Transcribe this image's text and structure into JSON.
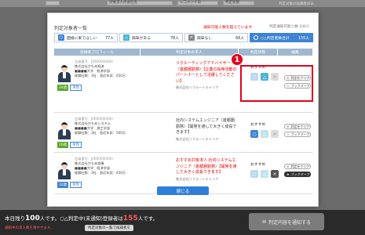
{
  "background": {
    "fields": [
      "",
      "対象求人の会社名",
      "レコメンド日",
      "判定状態"
    ],
    "checkbox_label": "判定対象の候補者のみ",
    "footer": {
      "line1_pre": "本日残り",
      "line1_num": "100",
      "line1_mid": "人です。○△判定中(未通知)登録者は",
      "line1_num2": "155",
      "line1_post": "人です。",
      "line2": "選択中の求人数を増やせます。",
      "link": "判定対象の一覧で候補者を",
      "notify_label": "判定内容を通知する"
    }
  },
  "modal": {
    "title": "判定対象者一覧",
    "notice": "通知可能人数を超えています",
    "limit": "判定通知可能人数 100人",
    "tabs": [
      {
        "label": "面接に来てほしい",
        "count": "77人",
        "icon": "circle",
        "color": "#3f84d4"
      },
      {
        "label": "興味がある",
        "count": "78人",
        "icon": "triangle",
        "color": "#4db3d3"
      },
      {
        "label": "興味なし",
        "count": "68人",
        "icon": "x",
        "color": "#888888"
      },
      {
        "label": "○△判定者数合計",
        "count": "155人",
        "icon": "circle",
        "color": "#3f84d4"
      }
    ],
    "headers": [
      "登録者プロフィール",
      "判定対象の求人",
      "判定状態",
      "編集"
    ],
    "rows": [
      {
        "id": "会員番号：J0000000000",
        "company": "株式会社かもめ経済",
        "school": "■■■■大学　経済学部",
        "exp": "経験社数：3社　直近年収：450万",
        "age": "24歳",
        "gender": "男性",
        "job": "リクルーティングアドバイザー（首都圏勤務）【企業の採用活動のパートナーとして活躍してください】",
        "job_company": "株式会社リクルートキャリア",
        "status": "おすすめ"
      },
      {
        "id": "会員番号：J0000000000",
        "company": "株式会社かもめシステム",
        "school": "■■■■大学　施工学部",
        "exp": "経験社数：3社　直近年収：500万",
        "age": "26歳",
        "gender": "男性",
        "job": "社内システムエンジニア（首都圏勤務）【開発を通して大きく成長できます】",
        "job_company": "株式会社リクルートキャリア",
        "status": "おすすめ"
      },
      {
        "id": "会員番号：J0000000000",
        "company": "株式会社かもめ商事",
        "school": "■■■■大学　経済学部",
        "exp": "経験社数：3社　直近年収：450万",
        "age": "32歳",
        "gender": "男性",
        "job": "おすすめ対象求人 社内システムエンジニア（首都圏勤務）【開発を通して大きく成長できます】",
        "job_company": "株式会社リクルートキャリア",
        "status": "おすすめ"
      }
    ],
    "edit_clear": "判定をクリア",
    "edit_bookmark": "ブックマーク",
    "close_label": "閉じる",
    "callout_number": "1"
  },
  "colors": {
    "accent": "#3f84d4",
    "alert": "#e0001b",
    "header": "#9fb8cf"
  }
}
